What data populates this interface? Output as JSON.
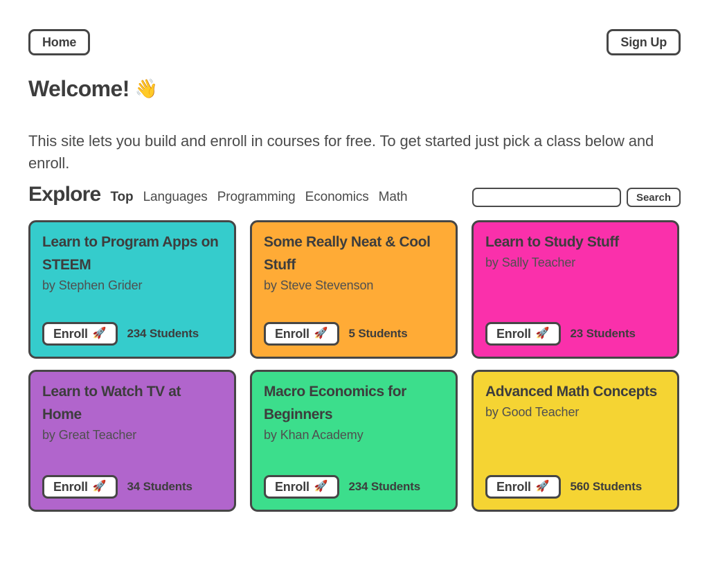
{
  "nav": {
    "home_label": "Home",
    "signup_label": "Sign Up"
  },
  "hero": {
    "heading": "Welcome!",
    "heading_emoji": "👋",
    "paragraph": "This site lets you build and enroll in courses for free. To get started just pick a class below and enroll."
  },
  "explore": {
    "title": "Explore",
    "links": [
      {
        "label": "Top",
        "active": true
      },
      {
        "label": "Languages",
        "active": false
      },
      {
        "label": "Programming",
        "active": false
      },
      {
        "label": "Economics",
        "active": false
      },
      {
        "label": "Math",
        "active": false
      }
    ],
    "search": {
      "value": "",
      "placeholder": "",
      "button_label": "Search"
    }
  },
  "cards": [
    {
      "title": "Learn to Program Apps on STEEM",
      "author": "by Stephen Grider",
      "enroll_label": "Enroll",
      "enroll_emoji": "🚀",
      "students": "234 Students",
      "color": "#35cccc"
    },
    {
      "title": "Some Really Neat & Cool Stuff",
      "author": "by Steve Stevenson",
      "enroll_label": "Enroll",
      "enroll_emoji": "🚀",
      "students": "5 Students",
      "color": "#ffab36"
    },
    {
      "title": "Learn to Study Stuff",
      "author": "by Sally Teacher",
      "enroll_label": "Enroll",
      "enroll_emoji": "🚀",
      "students": "23 Students",
      "color": "#fa30ab"
    },
    {
      "title": "Learn to Watch TV at Home",
      "author": "by Great Teacher",
      "enroll_label": "Enroll",
      "enroll_emoji": "🚀",
      "students": "34 Students",
      "color": "#b165cc"
    },
    {
      "title": "Macro Economics for Beginners",
      "author": "by Khan Academy",
      "enroll_label": "Enroll",
      "enroll_emoji": "🚀",
      "students": "234 Students",
      "color": "#3cde8c"
    },
    {
      "title": "Advanced Math Concepts",
      "author": "by Good Teacher",
      "enroll_label": "Enroll",
      "enroll_emoji": "🚀",
      "students": "560 Students",
      "color": "#f5d433"
    }
  ]
}
